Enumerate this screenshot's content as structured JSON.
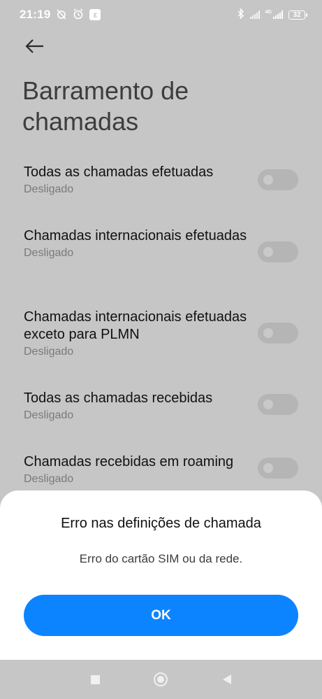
{
  "status_bar": {
    "time": "21:19",
    "icons": [
      "alarm-off-icon",
      "alarm-icon",
      "notification-icon",
      "bluetooth-icon",
      "signal-icon",
      "4g-signal-icon",
      "battery-icon"
    ],
    "network_label": "4G",
    "battery": "32"
  },
  "header": {
    "back_icon": "back-arrow-icon",
    "title": "Barramento de chamadas"
  },
  "settings": [
    {
      "title": "Todas as chamadas efetuadas",
      "status": "Desligado",
      "enabled": false
    },
    {
      "title": "Chamadas internacionais efetuadas",
      "status": "Desligado",
      "enabled": false
    },
    {
      "title": "Chamadas internacionais efetuadas exceto para PLMN",
      "status": "Desligado",
      "enabled": false
    },
    {
      "title": "Todas as chamadas recebidas",
      "status": "Desligado",
      "enabled": false
    },
    {
      "title": "Chamadas recebidas em roaming",
      "status": "Desligado",
      "enabled": false
    }
  ],
  "dialog": {
    "title": "Erro nas definições de chamada",
    "message": "Erro do cartão SIM ou da rede.",
    "ok_label": "OK"
  },
  "colors": {
    "accent": "#0d84ff",
    "dim_overlay_bg": "#c6c6c6"
  },
  "nav_bar": {
    "icons": [
      "recents-square-icon",
      "home-circle-icon",
      "back-triangle-icon"
    ]
  }
}
